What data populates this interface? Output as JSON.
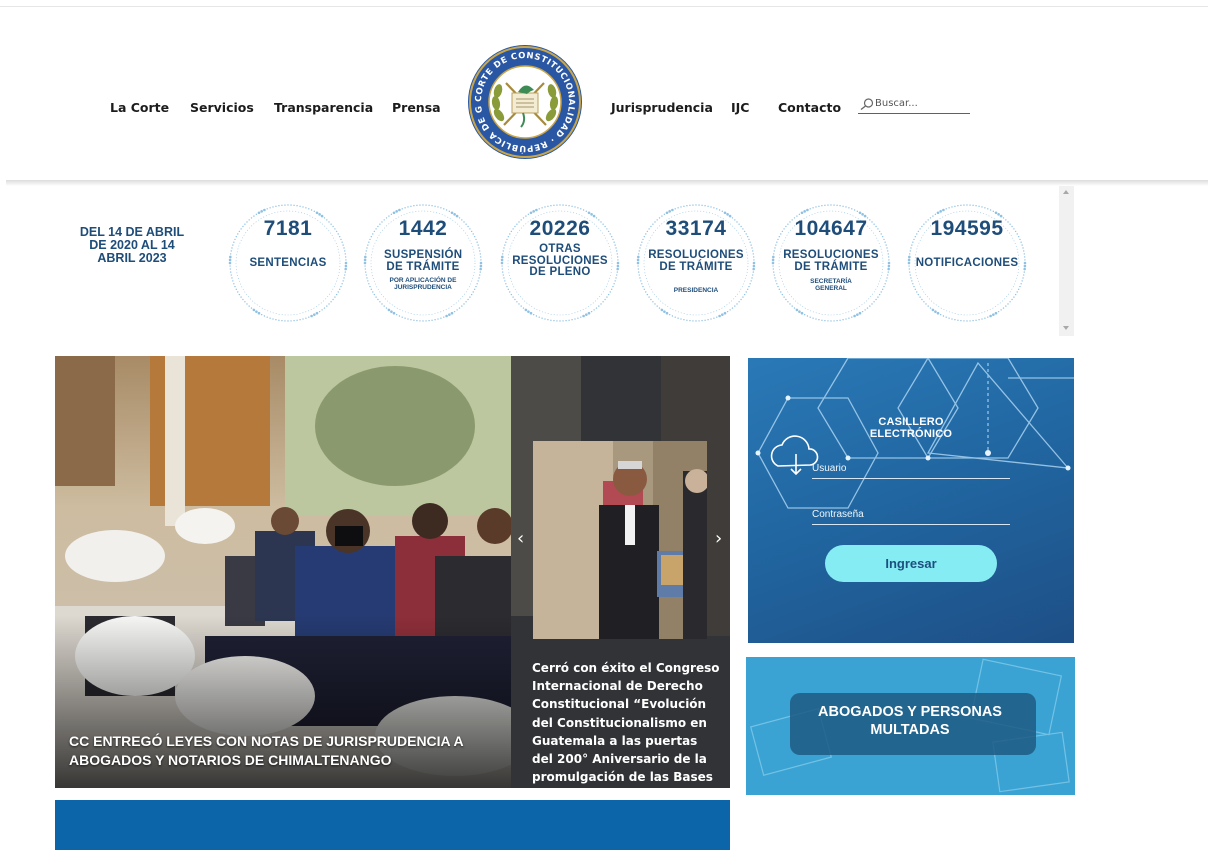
{
  "nav": {
    "left": [
      "La Corte",
      "Servicios",
      "Transparencia",
      "Prensa"
    ],
    "right": [
      "Jurisprudencia",
      "IJC",
      "Contacto"
    ],
    "logo_text": "CORTE DE CONSTITUCIONALIDAD · REPÚBLICA DE GUATEMALA"
  },
  "search": {
    "placeholder": "Buscar..."
  },
  "stats": {
    "period": "DEL 14 DE ABRIL DE 2020 AL 14 ABRIL 2023",
    "items": [
      {
        "value": "7181",
        "label": "SENTENCIAS",
        "sub": ""
      },
      {
        "value": "1442",
        "label": "SUSPENSIÓN DE TRÁMITE",
        "sub": "POR APLICACIÓN DE JURISPRUDENCIA"
      },
      {
        "value": "20226",
        "label": "OTRAS RESOLUCIONES DE PLENO",
        "sub": ""
      },
      {
        "value": "33174",
        "label": "RESOLUCIONES DE TRÁMITE",
        "sub": "PRESIDENCIA"
      },
      {
        "value": "104647",
        "label": "RESOLUCIONES DE TRÁMITE",
        "sub": "SECRETARÍA GENERAL"
      },
      {
        "value": "194595",
        "label": "NOTIFICACIONES",
        "sub": ""
      }
    ],
    "ring_color": "#8fc1e3",
    "text_color": "#1e4d7a"
  },
  "news": {
    "main_title": "CC ENTREGÓ LEYES CON NOTAS DE JURISPRUDENCIA A ABOGADOS Y NOTARIOS DE CHIMALTENANGO",
    "side_title": "Cerró con éxito el Congreso Internacional de Derecho Constitucional “Evolución del Constitucionalismo en Guatemala a las puertas del 200° Aniversario de la promulgación de las Bases",
    "prev_glyph": "‹",
    "next_glyph": "›"
  },
  "login": {
    "title": "CASILLERO ELECTRÓNICO",
    "user_placeholder": "Usuario",
    "pass_placeholder": "Contraseña",
    "button": "Ingresar",
    "button_color": "#86ecf3"
  },
  "banner": {
    "text": "ABOGADOS Y PERSONAS MULTADAS"
  },
  "colors": {
    "accent_blue": "#0c65a8",
    "header_text": "#1c1c1c"
  }
}
